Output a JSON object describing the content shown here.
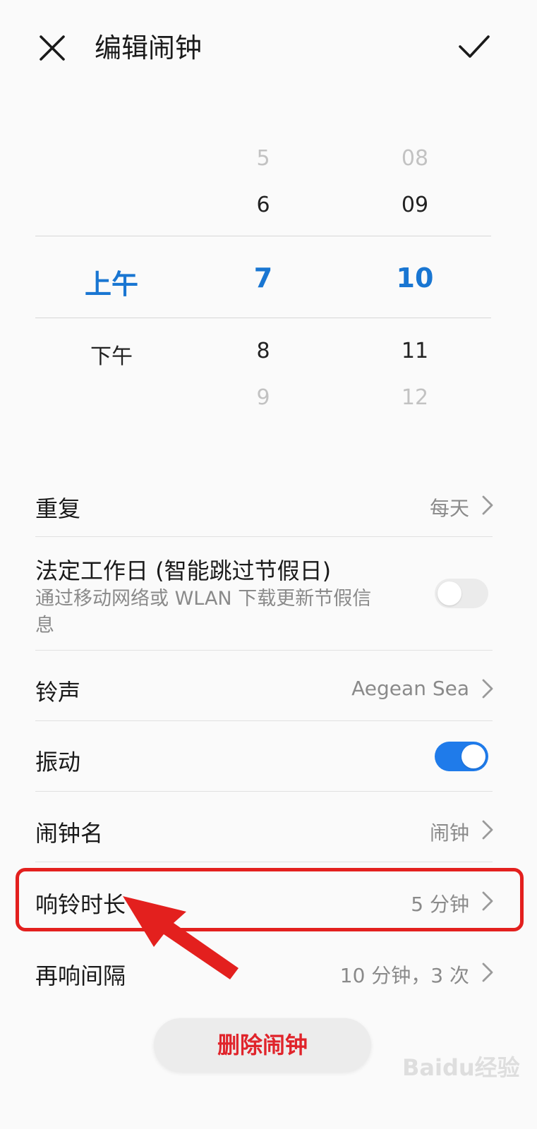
{
  "header": {
    "title": "编辑闹钟",
    "close_icon": "close-icon",
    "confirm_icon": "check-icon"
  },
  "picker": {
    "ampm": {
      "items": [
        "上午",
        "下午"
      ],
      "selected": "上午"
    },
    "hour": {
      "items": [
        "5",
        "6",
        "7",
        "8",
        "9"
      ],
      "selected": "7"
    },
    "minute": {
      "items": [
        "08",
        "09",
        "10",
        "11",
        "12"
      ],
      "selected": "10"
    }
  },
  "settings": {
    "repeat": {
      "label": "重复",
      "value": "每天"
    },
    "workday": {
      "label": "法定工作日 (智能跳过节假日)",
      "sub_line1": "通过移动网络或 WLAN 下载更新节假信",
      "sub_line2": "息",
      "enabled": false
    },
    "ringtone": {
      "label": "铃声",
      "value": "Aegean Sea"
    },
    "vibrate": {
      "label": "振动",
      "enabled": true
    },
    "name": {
      "label": "闹钟名",
      "value": "闹钟"
    },
    "duration": {
      "label": "响铃时长",
      "value": "5 分钟"
    },
    "snooze": {
      "label": "再响间隔",
      "value": "10 分钟，3 次"
    }
  },
  "delete_label": "删除闹钟",
  "watermark": "Baidu经验",
  "colors": {
    "accent": "#1976d2",
    "toggle_on": "#1f7bea",
    "delete_text": "#e0242b",
    "annotation": "#e3201e"
  }
}
